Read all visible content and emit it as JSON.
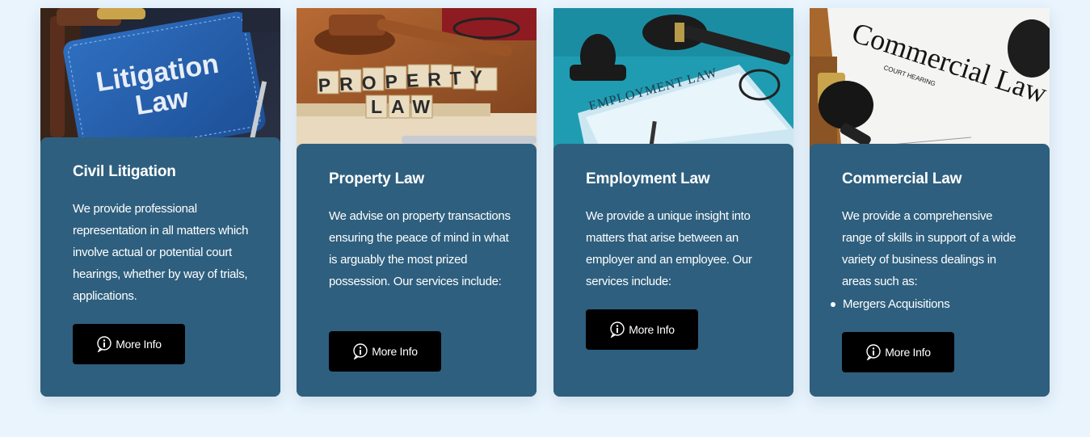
{
  "cards": [
    {
      "title": "Civil Litigation",
      "description": "We provide professional representation in all matters which involve actual or potential court hearings, whether by way of trials, applications.",
      "button_label": "More Info",
      "image_text": [
        "Litigation",
        "Law"
      ]
    },
    {
      "title": "Property Law",
      "description": "We advise on property transactions ensuring the peace of mind in what is arguably the most prized possession. Our services include:",
      "button_label": "More Info",
      "image_text": [
        "PROPERTY",
        "LAW"
      ]
    },
    {
      "title": "Employment Law",
      "description": "We provide a unique insight into matters that arise between an employer and an employee. Our services include:",
      "button_label": "More Info",
      "image_text": [
        "EMPLOYMENT LAW"
      ]
    },
    {
      "title": "Commercial Law",
      "description": "We provide a comprehensive range of skills in support of a wide variety of business dealings in areas such as:",
      "list": [
        "Mergers Acquisitions"
      ],
      "button_label": "More Info",
      "image_text": [
        "Commercial Law",
        "COURT HEARING"
      ]
    }
  ],
  "icons": {
    "button_icon": "info-bubble-icon"
  },
  "colors": {
    "page_bg": "#e9f4fd",
    "card_bg": "#2e5f7e",
    "button_bg": "#000000",
    "text": "#ffffff"
  }
}
